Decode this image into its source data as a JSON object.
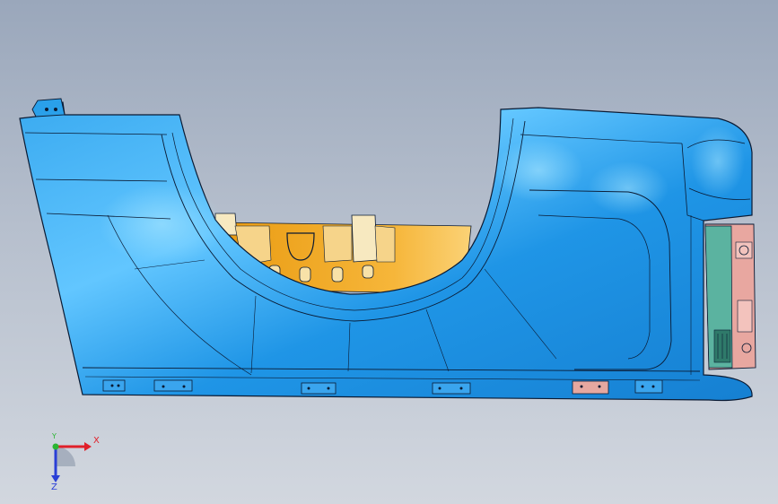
{
  "viewport": {
    "model": {
      "body_color": "#1e96e6",
      "body_highlight": "#6fd0ff",
      "inner_color": "#f2a516",
      "inner_highlight": "#ffd27a",
      "bracket_color": "#f7e9c0",
      "edge_color": "#0a1a33",
      "plate_color": "#f0a6a0",
      "plate_green": "#4aa38a"
    },
    "triad": {
      "x_label": "X",
      "y_label": "Y",
      "z_label": "Z",
      "x_color": "#e0202a",
      "y_color": "#2bb532",
      "z_color": "#2a3fd6"
    }
  }
}
